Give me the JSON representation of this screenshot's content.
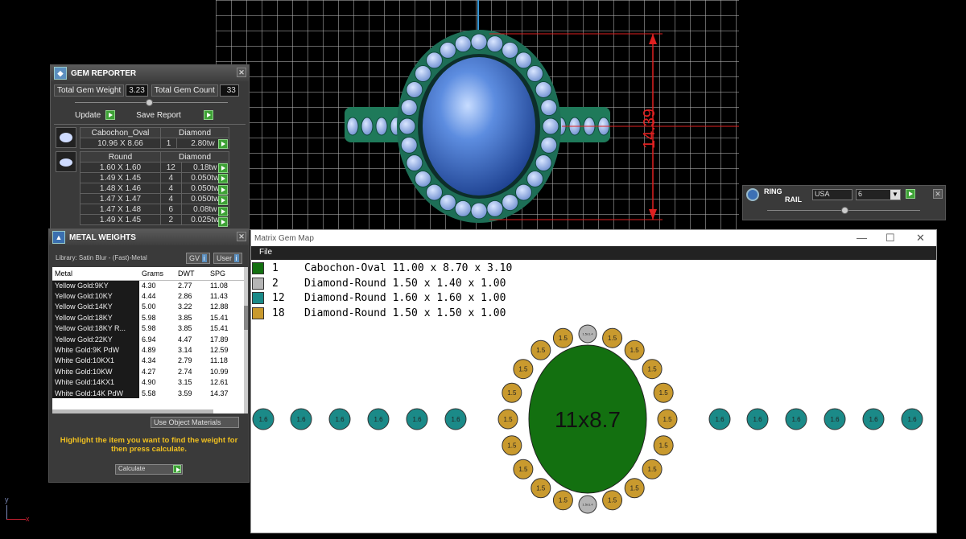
{
  "viewport": {
    "dimension_label": "14.39",
    "axis_y": "y",
    "axis_x": "x"
  },
  "gem_reporter": {
    "title": "GEM REPORTER",
    "total_weight_label": "Total Gem Weight",
    "total_weight_value": "3.23",
    "total_count_label": "Total Gem Count",
    "total_count_value": "33",
    "update_label": "Update",
    "save_report_label": "Save Report",
    "cabochon": {
      "shape": "Cabochon_Oval",
      "type": "Diamond",
      "size": "10.96 X 8.66",
      "count": "1",
      "weight": "2.80tw"
    },
    "round": {
      "shape": "Round",
      "type": "Diamond",
      "rows": [
        {
          "size": "1.60 X 1.60",
          "count": "12",
          "weight": "0.18tw"
        },
        {
          "size": "1.49 X 1.45",
          "count": "4",
          "weight": "0.050tw"
        },
        {
          "size": "1.48 X 1.46",
          "count": "4",
          "weight": "0.050tw"
        },
        {
          "size": "1.47 X 1.47",
          "count": "4",
          "weight": "0.050tw"
        },
        {
          "size": "1.47 X 1.48",
          "count": "6",
          "weight": "0.08tw"
        },
        {
          "size": "1.49 X 1.45",
          "count": "2",
          "weight": "0.025tw"
        }
      ]
    }
  },
  "metal_weights": {
    "title": "METAL WEIGHTS",
    "library": "Library: Satin Blur - (Fast)-Metal",
    "gv_label": "GV",
    "user_label": "User",
    "columns": [
      "Metal",
      "Grams",
      "DWT",
      "SPG"
    ],
    "rows": [
      {
        "metal": "Yellow Gold:9KY",
        "grams": "4.30",
        "dwt": "2.77",
        "spg": "11.08"
      },
      {
        "metal": "Yellow Gold:10KY",
        "grams": "4.44",
        "dwt": "2.86",
        "spg": "11.43"
      },
      {
        "metal": "Yellow Gold:14KY",
        "grams": "5.00",
        "dwt": "3.22",
        "spg": "12.88"
      },
      {
        "metal": "Yellow Gold:18KY",
        "grams": "5.98",
        "dwt": "3.85",
        "spg": "15.41"
      },
      {
        "metal": "Yellow Gold:18KY R...",
        "grams": "5.98",
        "dwt": "3.85",
        "spg": "15.41"
      },
      {
        "metal": "Yellow Gold:22KY",
        "grams": "6.94",
        "dwt": "4.47",
        "spg": "17.89"
      },
      {
        "metal": "White Gold:9K PdW",
        "grams": "4.89",
        "dwt": "3.14",
        "spg": "12.59"
      },
      {
        "metal": "White Gold:10KX1",
        "grams": "4.34",
        "dwt": "2.79",
        "spg": "11.18"
      },
      {
        "metal": "White Gold:10KW",
        "grams": "4.27",
        "dwt": "2.74",
        "spg": "10.99"
      },
      {
        "metal": "White Gold:14KX1",
        "grams": "4.90",
        "dwt": "3.15",
        "spg": "12.61"
      },
      {
        "metal": "White Gold:14K PdW",
        "grams": "5.58",
        "dwt": "3.59",
        "spg": "14.37"
      }
    ],
    "use_object_materials": "Use Object Materials",
    "instruction": "Highlight the item you want to find the weight for then press calculate.",
    "calculate_label": "Calculate"
  },
  "ring_rail": {
    "title_line1": "RING",
    "title_line2": "RAIL",
    "region": "USA",
    "size": "6"
  },
  "gem_map": {
    "title": "Matrix Gem Map",
    "menu_file": "File",
    "legend": [
      {
        "count": "1",
        "desc": "Cabochon-Oval 11.00 x 8.70 x 3.10",
        "color": "#137010"
      },
      {
        "count": "2",
        "desc": "Diamond-Round 1.50 x 1.40 x 1.00",
        "color": "#b5b5b5"
      },
      {
        "count": "12",
        "desc": "Diamond-Round 1.60 x 1.60 x 1.00",
        "color": "#1b8a88"
      },
      {
        "count": "18",
        "desc": "Diamond-Round 1.50 x 1.50 x 1.00",
        "color": "#c99a2e"
      }
    ],
    "center_label": "11x8.7",
    "small_label": "1.6",
    "halo_label": "1.5",
    "tiny_label": "1.5x1.4"
  }
}
